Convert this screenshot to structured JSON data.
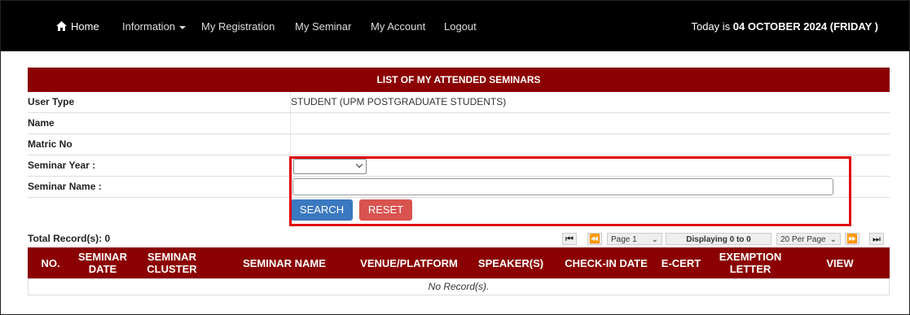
{
  "navbar": {
    "home": "Home",
    "information": "Information",
    "my_registration": "My Registration",
    "my_seminar": "My Seminar",
    "my_account": "My Account",
    "logout": "Logout",
    "today_prefix": "Today is ",
    "today_value": "04 OCTOBER 2024 (FRIDAY )"
  },
  "panel": {
    "title": "LIST OF MY ATTENDED SEMINARS",
    "user_type_label": "User Type",
    "user_type_value": "STUDENT (UPM POSTGRADUATE STUDENTS)",
    "name_label": "Name",
    "name_value": "",
    "matric_label": "Matric No",
    "matric_value": "",
    "year_label": "Seminar Year :",
    "year_value": "",
    "seminar_name_label": "Seminar Name :",
    "seminar_name_value": "",
    "search_button": "SEARCH",
    "reset_button": "RESET"
  },
  "grid": {
    "total_records": "Total Record(s): 0",
    "page_select": "Page 1",
    "displaying": "Displaying 0 to 0",
    "per_page": "20 Per Page",
    "columns": [
      "NO.",
      "SEMINAR DATE",
      "SEMINAR CLUSTER",
      "SEMINAR NAME",
      "VENUE/PLATFORM",
      "SPEAKER(S)",
      "CHECK-IN DATE",
      "E-CERT",
      "EXEMPTION LETTER",
      "VIEW"
    ],
    "empty_message": "No Record(s)."
  },
  "colors": {
    "header_red": "#8b0000",
    "search_blue": "#3a78c0",
    "reset_red": "#d9534f",
    "highlight": "#e00000"
  }
}
